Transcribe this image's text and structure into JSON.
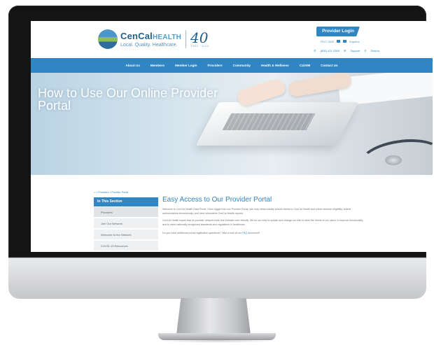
{
  "site": {
    "logo": {
      "brand_main": "CenCal",
      "brand_accent": "HEALTH",
      "tagline": "Local. Quality. Healthcare.",
      "anniversary": "40",
      "anniversary_sub": "1983 · 2023"
    },
    "header": {
      "provider_login": "Provider Login",
      "util_links_top": [
        "TEXT SIZE",
        "Español"
      ],
      "phone": "(805) 421-2500",
      "support": "Support",
      "search": "Search"
    },
    "nav": [
      "About Us",
      "Members",
      "Member Login",
      "Providers",
      "Community",
      "Health & Wellness",
      "CalAIM",
      "Contact Us"
    ],
    "hero": {
      "title": "How to Use Our Online Provider Portal"
    },
    "breadcrumb": "⌂ » Providers » Provider Portal",
    "sidebar": {
      "heading": "In This Section",
      "items": [
        "Providers",
        "Join Our Network",
        "Welcome to the Network",
        "COVID-19 Resources"
      ]
    },
    "main": {
      "title": "Easy Access to Our Provider Portal",
      "paragraphs": [
        "Welcome to CenCal Health Data Portal. Once logged into our Provider Portal, you may electronically submit claims to CenCal Health and check member eligibility, submit authorizations electronically, and view informative CenCal Health reports.",
        "CenCal Health hopes that its provider network finds this Website user-friendly. We do our best to update and change our site to meet the needs of our users, to improve functionality, and to meet nationally recognized standards and regulations in healthcare."
      ],
      "faq_text": "Do you have additional portal registration questions? Take a look at our",
      "faq_link": "FAQ",
      "faq_tail": "document!"
    }
  },
  "colors": {
    "brand_blue": "#2f86c3",
    "bezel": "#141414",
    "chin": "#d6d7da"
  }
}
